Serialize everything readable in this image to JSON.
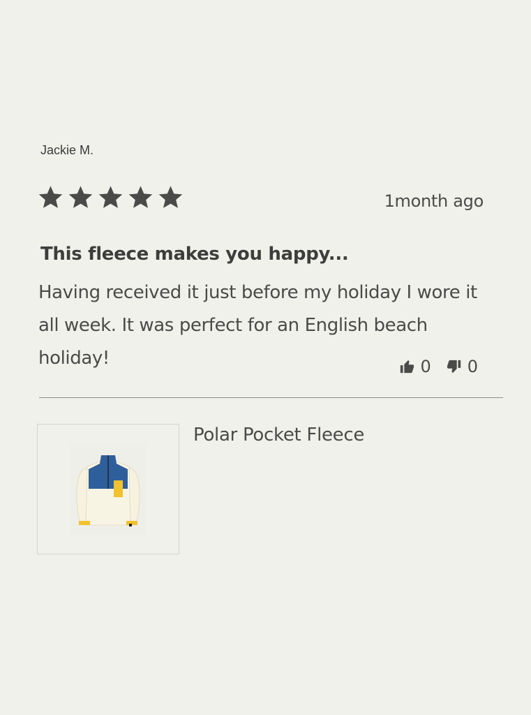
{
  "review": {
    "reviewer": "Jackie M.",
    "rating": 5,
    "max_rating": 5,
    "timestamp": "1month ago",
    "title": "This fleece makes you happy...",
    "body": "Having received it just before my holiday I wore it all week. It was perfect for an English beach holiday!",
    "votes": {
      "up_count": "0",
      "down_count": "0"
    }
  },
  "product": {
    "name": "Polar Pocket Fleece"
  },
  "colors": {
    "background": "#f1f1ec",
    "text": "#4a4a48",
    "star": "#4a4a48",
    "divider": "#8d8d8a",
    "fleece_body": "#f7f2df",
    "fleece_panel": "#2f5f9a",
    "fleece_accent": "#f2c12e"
  },
  "icons": {
    "star": "star-icon",
    "thumbs_up": "thumbs-up-icon",
    "thumbs_down": "thumbs-down-icon"
  }
}
